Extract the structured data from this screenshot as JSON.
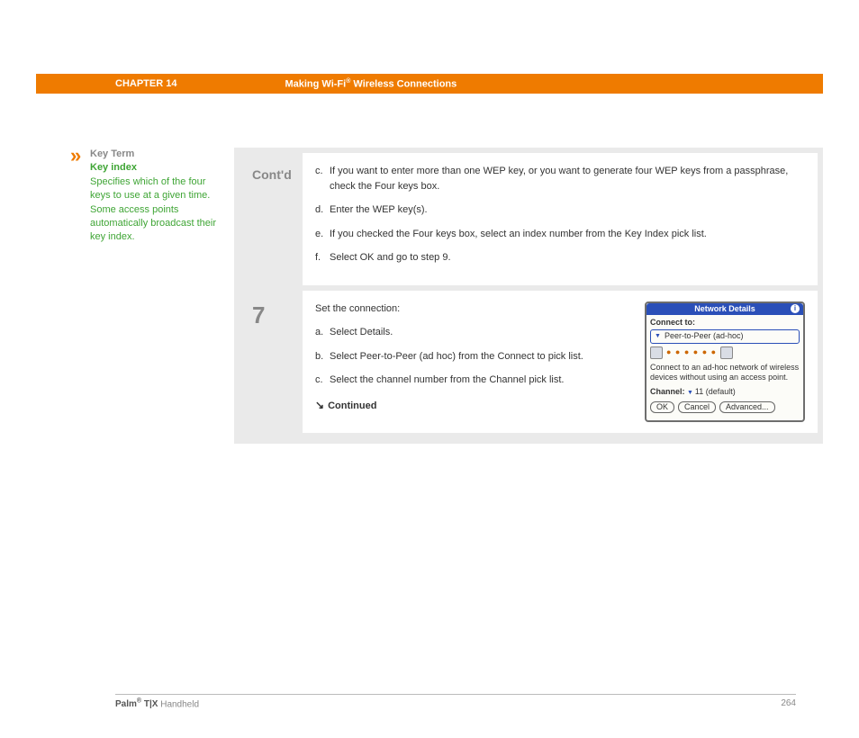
{
  "header": {
    "chapter": "CHAPTER 14",
    "title_pre": "Making Wi-Fi",
    "title_sup": "®",
    "title_post": " Wireless Connections"
  },
  "sidebar": {
    "marker": "»",
    "keyterm_label": "Key Term",
    "keyterm_name": "Key index",
    "keyterm_desc": "Specifies which of the four keys to use at a given time. Some access points automatically broadcast their key index."
  },
  "steps": {
    "contd": {
      "num": "Cont'd",
      "items": [
        {
          "lbl": "c.",
          "txt": "If you want to enter more than one WEP key, or you want to generate four WEP keys from a passphrase, check the Four keys box."
        },
        {
          "lbl": "d.",
          "txt": "Enter the WEP key(s)."
        },
        {
          "lbl": "e.",
          "txt": "If you checked the Four keys box, select an index number from the Key Index pick list."
        },
        {
          "lbl": "f.",
          "txt": "Select OK and go to step 9."
        }
      ]
    },
    "seven": {
      "num": "7",
      "intro": "Set the connection:",
      "items": [
        {
          "lbl": "a.",
          "txt": "Select Details."
        },
        {
          "lbl": "b.",
          "txt": "Select Peer-to-Peer (ad hoc) from the Connect to pick list."
        },
        {
          "lbl": "c.",
          "txt": "Select the channel number from the Channel pick list."
        }
      ],
      "continued": "Continued"
    }
  },
  "device": {
    "title": "Network Details",
    "connect_label": "Connect to:",
    "connect_value": "Peer-to-Peer (ad-hoc)",
    "signal": "● ● ● ● ● ●",
    "desc": "Connect to an ad-hoc network of wireless devices without using an access point.",
    "channel_label": "Channel:",
    "channel_value": "11 (default)",
    "btn_ok": "OK",
    "btn_cancel": "Cancel",
    "btn_adv": "Advanced..."
  },
  "footer": {
    "brand_pre": "Palm",
    "brand_sup": "®",
    "brand_strong": " T|X",
    "brand_post": " Handheld",
    "page": "264"
  }
}
